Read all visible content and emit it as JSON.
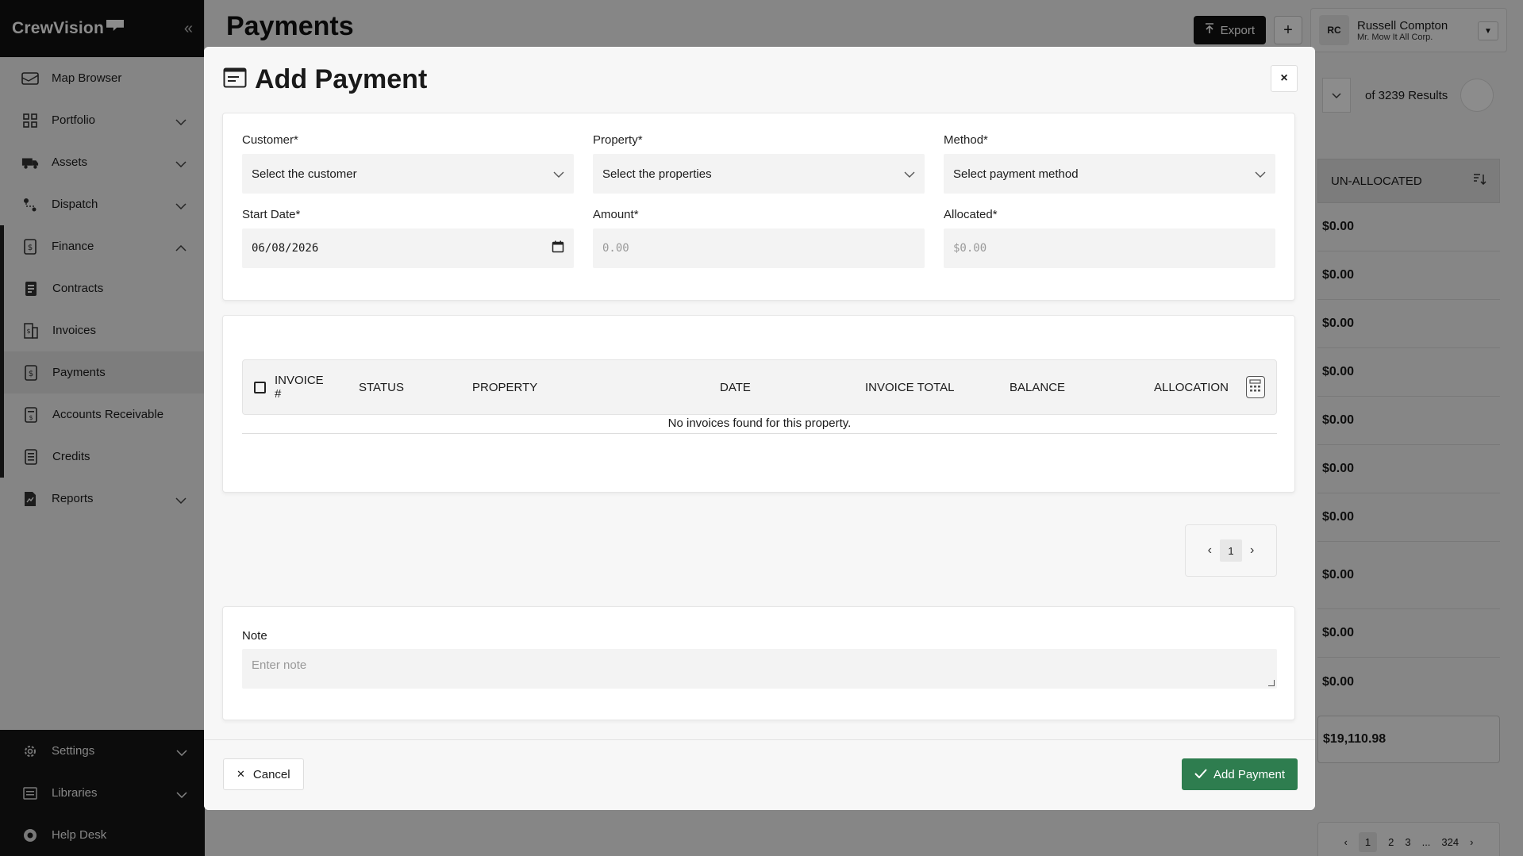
{
  "sidebar": {
    "brand": "CrewVision",
    "items": [
      {
        "label": "Map Browser"
      },
      {
        "label": "Portfolio"
      },
      {
        "label": "Assets"
      },
      {
        "label": "Dispatch"
      },
      {
        "label": "Finance"
      },
      {
        "label": "Contracts"
      },
      {
        "label": "Invoices"
      },
      {
        "label": "Payments"
      },
      {
        "label": "Accounts Receivable"
      },
      {
        "label": "Credits"
      },
      {
        "label": "Reports"
      }
    ],
    "bottom": [
      {
        "label": "Settings"
      },
      {
        "label": "Libraries"
      },
      {
        "label": "Help Desk"
      }
    ]
  },
  "header": {
    "title": "Payments",
    "export_label": "Export",
    "plus_label": "+",
    "user": {
      "initials": "RC",
      "name": "Russell Compton",
      "org": "Mr. Mow It All Corp."
    }
  },
  "background": {
    "results_text": "of 3239 Results",
    "column_header": "UN-ALLOCATED",
    "cells": [
      "$0.00",
      "$0.00",
      "$0.00",
      "$0.00",
      "$0.00",
      "$0.00",
      "$0.00",
      "$0.00",
      "$0.00",
      "$0.00"
    ],
    "total": "$19,110.98",
    "pages": [
      "1",
      "2",
      "3",
      "...",
      "324"
    ]
  },
  "modal": {
    "title": "Add Payment",
    "close_label": "×",
    "fields": {
      "customer": {
        "label": "Customer*",
        "placeholder": "Select the customer"
      },
      "property": {
        "label": "Property*",
        "placeholder": "Select the properties"
      },
      "method": {
        "label": "Method*",
        "placeholder": "Select payment method"
      },
      "start_date": {
        "label": "Start Date*",
        "value": "06/08/2026"
      },
      "amount": {
        "label": "Amount*",
        "placeholder": "0.00"
      },
      "allocated": {
        "label": "Allocated*",
        "placeholder": "$0.00"
      }
    },
    "table": {
      "columns": [
        "INVOICE #",
        "STATUS",
        "PROPERTY",
        "DATE",
        "INVOICE TOTAL",
        "BALANCE",
        "ALLOCATION"
      ],
      "empty_message": "No invoices found for this property."
    },
    "pager": {
      "current": "1"
    },
    "note": {
      "label": "Note",
      "placeholder": "Enter note"
    },
    "cancel_label": "Cancel",
    "add_label": "Add Payment"
  },
  "colors": {
    "primary_button": "#2e7d4f",
    "dark": "#111111"
  }
}
